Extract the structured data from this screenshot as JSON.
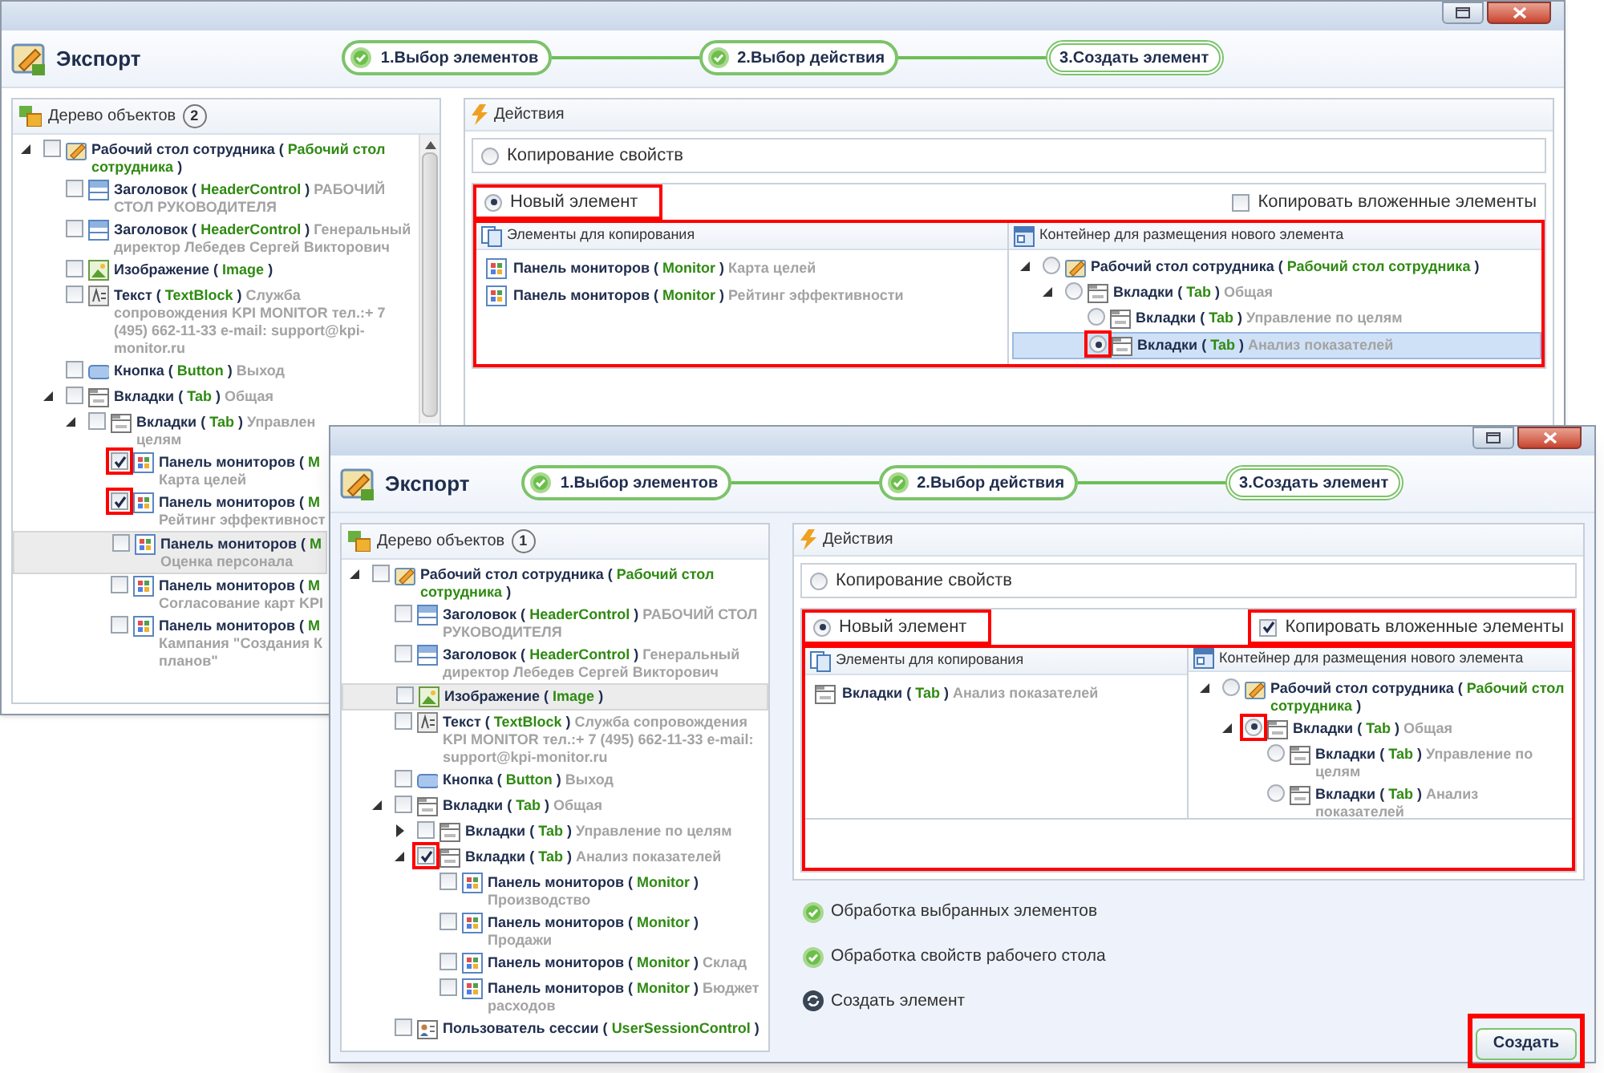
{
  "windows": [
    {
      "title": "Экспорт",
      "steps": [
        {
          "label": "1.Выбор элементов",
          "completed": true,
          "selected": false
        },
        {
          "label": "2.Выбор действия",
          "completed": true,
          "selected": false
        },
        {
          "label": "3.Создать элемент",
          "completed": false,
          "selected": true
        }
      ],
      "tree": {
        "title": "Дерево объектов",
        "count": "2",
        "nodes": [
          {
            "name": "Рабочий стол сотрудника (",
            "type": "Рабочий стол сотрудника",
            "close": ")",
            "kind": "desktop",
            "checked": false,
            "expanded": true,
            "children": [
              {
                "name": "Заголовок (",
                "type": "HeaderControl",
                "close": ")",
                "desc": "РАБОЧИЙ СТОЛ РУКОВОДИТЕЛЯ",
                "kind": "header",
                "checked": false
              },
              {
                "name": "Заголовок (",
                "type": "HeaderControl",
                "close": ")",
                "desc": "Генеральный  директор Лебедев Сергей Викторович",
                "kind": "header",
                "checked": false
              },
              {
                "name": "Изображение (",
                "type": "Image",
                "close": ")",
                "kind": "image",
                "checked": false
              },
              {
                "name": "Текст (",
                "type": "TextBlock",
                "close": ")",
                "desc": "Служба сопровождения KPI MONITOR тел.:+ 7 (495) 662-11-33 e-mail: support@kpi-monitor.ru",
                "kind": "textblock",
                "checked": false
              },
              {
                "name": "Кнопка (",
                "type": "Button",
                "close": ")",
                "desc": "Выход",
                "kind": "button",
                "checked": false
              },
              {
                "name": "Вкладки (",
                "type": "Tab",
                "close": ")",
                "desc": "Общая",
                "kind": "tab",
                "checked": false,
                "expanded": true,
                "children": [
                  {
                    "name": "Вкладки (",
                    "type": "Tab",
                    "close": ")",
                    "desc": "Управлен\nцелям",
                    "kind": "tab",
                    "checked": false,
                    "expanded": true,
                    "children": [
                      {
                        "name": "Панель мониторов (",
                        "type": "M",
                        "desc": "Карта целей",
                        "kind": "monitor",
                        "checked": true,
                        "annotated": true
                      },
                      {
                        "name": "Панель мониторов (",
                        "type": "M",
                        "desc": "Рейтинг эффективност",
                        "kind": "monitor",
                        "checked": true,
                        "annotated": true
                      },
                      {
                        "name": "Панель мониторов (",
                        "type": "M",
                        "desc": "Оценка персонала",
                        "kind": "monitor",
                        "checked": false,
                        "hovered": true
                      },
                      {
                        "name": "Панель мониторов (",
                        "type": "M",
                        "desc": "Согласование карт KPI",
                        "kind": "monitor",
                        "checked": false
                      },
                      {
                        "name": "Панель мониторов (",
                        "type": "M",
                        "desc": "Кампания \"Создания К\nпланов\"",
                        "kind": "monitor",
                        "checked": false
                      }
                    ]
                  }
                ]
              }
            ]
          }
        ]
      },
      "actions": {
        "title": "Действия",
        "options": [
          {
            "label": "Копирование свойств",
            "selected": false
          },
          {
            "label": "Новый элемент",
            "selected": true,
            "annotated": true
          }
        ],
        "copy_nested": {
          "label": "Копировать вложенные элементы",
          "checked": false
        },
        "panel": {
          "annotated": true,
          "left_title": "Элементы для копирования",
          "right_title": "Контейнер для размещения нового элемента",
          "items": [
            {
              "name": "Панель мониторов (",
              "type": "Monitor",
              "close": ")",
              "desc": "Карта целей",
              "kind": "monitor"
            },
            {
              "name": "Панель мониторов (",
              "type": "Monitor",
              "close": ")",
              "desc": "Рейтинг эффективности",
              "kind": "monitor"
            }
          ],
          "container": [
            {
              "name": "Рабочий стол сотрудника (",
              "type": "Рабочий стол сотрудника",
              "close": ")",
              "kind": "desktop",
              "selected": false,
              "expanded": true,
              "children": [
                {
                  "name": "Вкладки (",
                  "type": "Tab",
                  "close": ")",
                  "desc": "Общая",
                  "kind": "tab",
                  "selected": false,
                  "expanded": true,
                  "children": [
                    {
                      "name": "Вкладки (",
                      "type": "Tab",
                      "close": ")",
                      "desc": "Управление по целям",
                      "kind": "tab",
                      "selected": false
                    },
                    {
                      "name": "Вкладки (",
                      "type": "Tab",
                      "close": ")",
                      "desc": "Анализ показателей",
                      "kind": "tab",
                      "selected": true,
                      "annotated": true,
                      "hovered": true
                    }
                  ]
                }
              ]
            }
          ]
        }
      }
    },
    {
      "title": "Экспорт",
      "steps": [
        {
          "label": "1.Выбор элементов",
          "completed": true,
          "selected": false
        },
        {
          "label": "2.Выбор действия",
          "completed": true,
          "selected": false
        },
        {
          "label": "3.Создать элемент",
          "completed": false,
          "selected": true
        }
      ],
      "tree": {
        "title": "Дерево объектов",
        "count": "1",
        "nodes": [
          {
            "name": "Рабочий стол сотрудника (",
            "type": "Рабочий стол сотрудника",
            "close": ")",
            "kind": "desktop",
            "checked": false,
            "expanded": true,
            "children": [
              {
                "name": "Заголовок (",
                "type": "HeaderControl",
                "close": ")",
                "desc": "РАБОЧИЙ СТОЛ РУКОВОДИТЕЛЯ",
                "kind": "header",
                "checked": false
              },
              {
                "name": "Заголовок (",
                "type": "HeaderControl",
                "close": ")",
                "desc": "Генеральный директор Лебедев Сергей Викторович",
                "kind": "header",
                "checked": false
              },
              {
                "name": "Изображение (",
                "type": "Image",
                "close": ")",
                "kind": "image",
                "checked": false,
                "hovered": true
              },
              {
                "name": "Текст (",
                "type": "TextBlock",
                "close": ")",
                "desc": "Служба сопровождения KPI MONITOR тел.:+ 7 (495) 662-11-33 e-mail: support@kpi-monitor.ru",
                "kind": "textblock",
                "checked": false
              },
              {
                "name": "Кнопка (",
                "type": "Button",
                "close": ")",
                "desc": "Выход",
                "kind": "button",
                "checked": false
              },
              {
                "name": "Вкладки (",
                "type": "Tab",
                "close": ")",
                "desc": "Общая",
                "kind": "tab",
                "checked": false,
                "expanded": true,
                "children": [
                  {
                    "name": "Вкладки (",
                    "type": "Tab",
                    "close": ")",
                    "desc": "Управление по целям",
                    "kind": "tab",
                    "checked": false,
                    "expanded": false
                  },
                  {
                    "name": "Вкладки (",
                    "type": "Tab",
                    "close": ")",
                    "desc": "Анализ показателей",
                    "kind": "tab",
                    "checked": true,
                    "annotated": true,
                    "expanded": true,
                    "children": [
                      {
                        "name": "Панель мониторов (",
                        "type": "Monitor",
                        "close": ")",
                        "desc": "Производство",
                        "kind": "monitor",
                        "checked": false
                      },
                      {
                        "name": "Панель мониторов (",
                        "type": "Monitor",
                        "close": ")",
                        "desc": "Продажи",
                        "kind": "monitor",
                        "checked": false
                      },
                      {
                        "name": "Панель мониторов (",
                        "type": "Monitor",
                        "close": ")",
                        "desc": "Склад",
                        "kind": "monitor",
                        "checked": false
                      },
                      {
                        "name": "Панель мониторов (",
                        "type": "Monitor",
                        "close": ")",
                        "desc": "Бюджет расходов",
                        "kind": "monitor",
                        "checked": false
                      }
                    ]
                  }
                ]
              },
              {
                "name": "Пользователь сессии (",
                "type": "UserSessionControl",
                "close": ")",
                "kind": "user",
                "checked": false
              }
            ]
          }
        ]
      },
      "actions": {
        "title": "Действия",
        "options": [
          {
            "label": "Копирование свойств",
            "selected": false
          },
          {
            "label": "Новый элемент",
            "selected": true,
            "annotated": true
          }
        ],
        "copy_nested": {
          "label": "Копировать вложенные элементы",
          "checked": true,
          "annotated": true
        },
        "panel": {
          "annotated": true,
          "left_title": "Элементы для копирования",
          "right_title": "Контейнер для размещения нового элемента",
          "items": [
            {
              "name": "Вкладки (",
              "type": "Tab",
              "close": ")",
              "desc": "Анализ показателей",
              "kind": "tab"
            }
          ],
          "container": [
            {
              "name": "Рабочий стол сотрудника (",
              "type": "Рабочий стол сотрудника",
              "close": ")",
              "kind": "desktop",
              "selected": false,
              "expanded": true,
              "children": [
                {
                  "name": "Вкладки (",
                  "type": "Tab",
                  "close": ")",
                  "desc": "Общая",
                  "kind": "tab",
                  "selected": true,
                  "annotated": true,
                  "expanded": true,
                  "children": [
                    {
                      "name": "Вкладки (",
                      "type": "Tab",
                      "close": ")",
                      "desc": "Управление по целям",
                      "kind": "tab",
                      "selected": false
                    },
                    {
                      "name": "Вкладки (",
                      "type": "Tab",
                      "close": ")",
                      "desc": "Анализ показателей",
                      "kind": "tab",
                      "selected": false
                    }
                  ]
                }
              ]
            }
          ]
        }
      },
      "progress": [
        {
          "label": "Обработка выбранных элементов",
          "done": true
        },
        {
          "label": "Обработка свойств рабочего стола",
          "done": true
        },
        {
          "label": "Создать элемент",
          "done": false
        }
      ],
      "create_button": {
        "label": "Создать",
        "annotated": true
      }
    }
  ]
}
